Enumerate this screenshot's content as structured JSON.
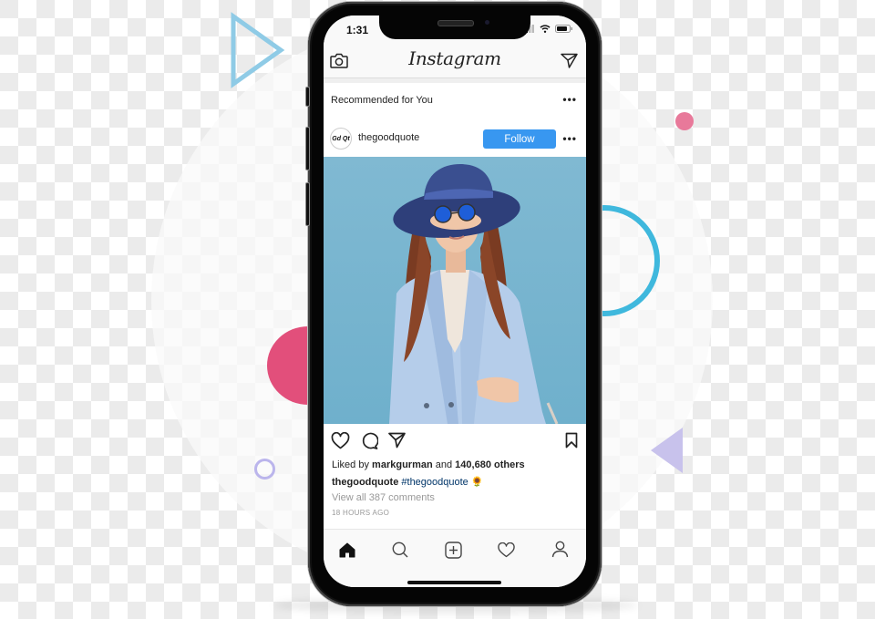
{
  "status_bar": {
    "time": "1:31",
    "icons": [
      "signal-icon",
      "wifi-icon",
      "battery-icon"
    ]
  },
  "header": {
    "app_title": "Instagram",
    "left_icon": "camera-icon",
    "right_icon": "direct-message-icon"
  },
  "recommended": {
    "label": "Recommended for You",
    "menu_icon": "more-options-icon"
  },
  "post": {
    "avatar_text": "Gd Qt",
    "username": "thegoodquote",
    "follow_label": "Follow",
    "menu_icon": "more-options-icon",
    "image_alt": "Woman in a wide blue hat, round blue sunglasses and light blue blazer against a light blue background",
    "actions": [
      "heart-icon",
      "comment-icon",
      "share-icon",
      "bookmark-icon"
    ],
    "likes": {
      "prefix": "Liked by",
      "user": "markgurman",
      "middle": "and",
      "count": "140,680 others"
    },
    "caption": {
      "user": "thegoodquote",
      "hashtag": "#thegoodquote",
      "emoji": "🌻"
    },
    "comments_link": "View all 387 comments",
    "timestamp": "18 HOURS AGO"
  },
  "tabbar": {
    "items": [
      "home-icon",
      "search-icon",
      "new-post-icon",
      "activity-heart-icon",
      "profile-icon"
    ],
    "active": "home-icon"
  },
  "colors": {
    "follow_blue": "#3897f0",
    "hashtag_blue": "#003569",
    "deco_pink": "#e24f7b",
    "deco_cyan": "#3fb8dd",
    "deco_lilac": "#bbb5ec",
    "photo_bg": "#7ab5cf"
  }
}
